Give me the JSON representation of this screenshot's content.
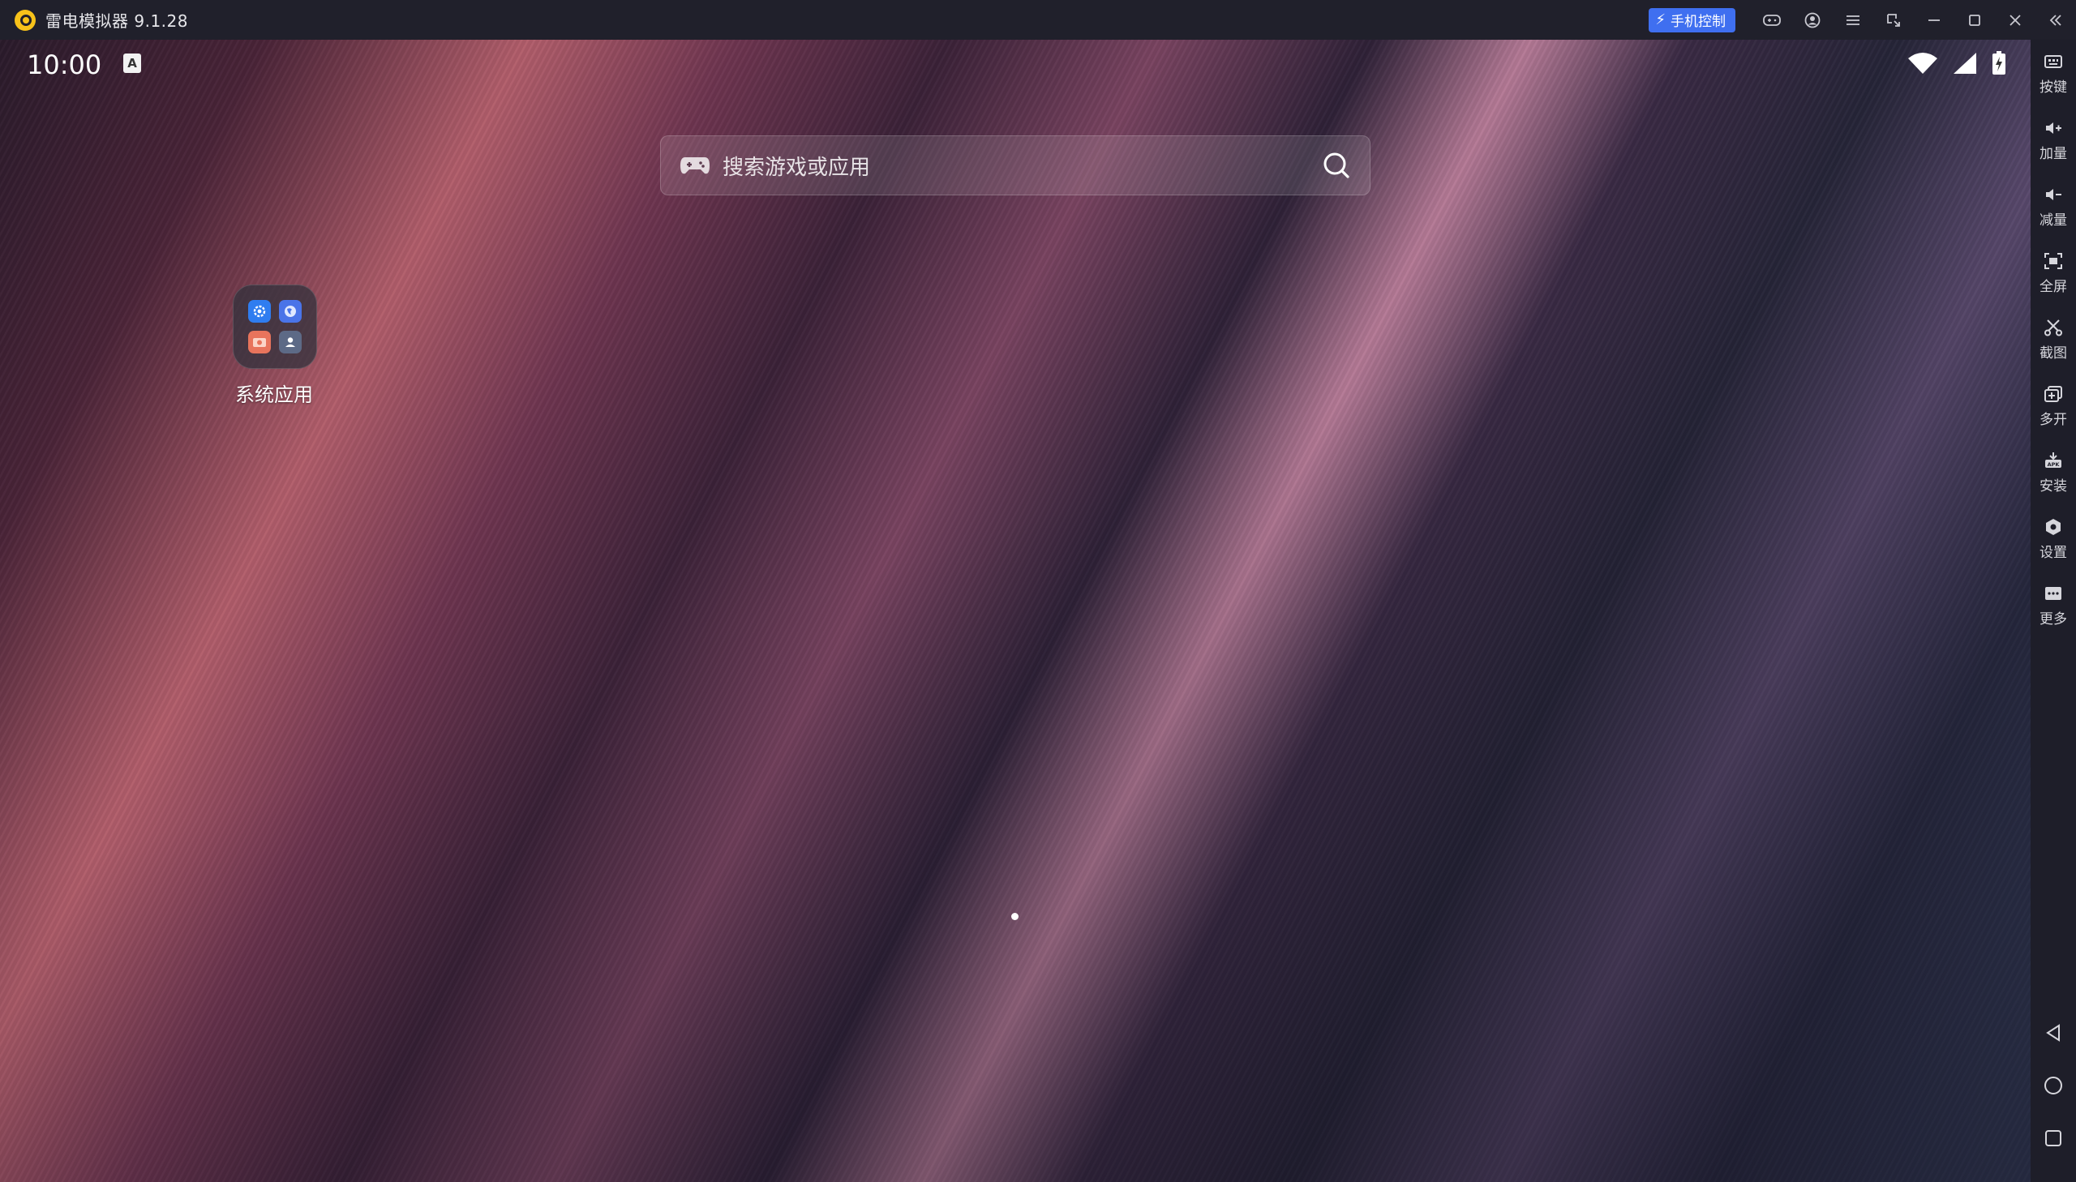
{
  "window": {
    "title": "雷电模拟器 9.1.28"
  },
  "titlebar": {
    "phone_control_label": "手机控制",
    "icons": [
      "gamepad-icon",
      "user-icon",
      "menu-icon",
      "shrink-window-icon",
      "minimize-icon",
      "maximize-icon",
      "close-icon",
      "collapse-sidebar-icon"
    ]
  },
  "statusbar": {
    "time": "10:00",
    "keyboard_indicator": "A",
    "icons": [
      "wifi-icon",
      "signal-icon",
      "battery-charging-icon"
    ]
  },
  "search": {
    "placeholder": "搜索游戏或应用"
  },
  "folder": {
    "label": "系统应用",
    "apps": [
      "settings-app-icon",
      "browser-app-icon",
      "camera-app-icon",
      "contacts-app-icon"
    ]
  },
  "sidebar": {
    "items": [
      {
        "label": "按键",
        "icon": "keymap-icon"
      },
      {
        "label": "加量",
        "icon": "volume-up-icon"
      },
      {
        "label": "减量",
        "icon": "volume-down-icon"
      },
      {
        "label": "全屏",
        "icon": "fullscreen-icon"
      },
      {
        "label": "截图",
        "icon": "screenshot-icon"
      },
      {
        "label": "多开",
        "icon": "multi-instance-icon"
      },
      {
        "label": "安装",
        "icon": "install-apk-icon"
      },
      {
        "label": "设置",
        "icon": "settings-icon"
      },
      {
        "label": "更多",
        "icon": "more-icon"
      }
    ],
    "nav": [
      "back-icon",
      "home-icon",
      "recents-icon"
    ]
  },
  "colors": {
    "accent": "#3f6ff0",
    "logo": "#f7c21a",
    "titlebar_bg": "#20202b"
  }
}
